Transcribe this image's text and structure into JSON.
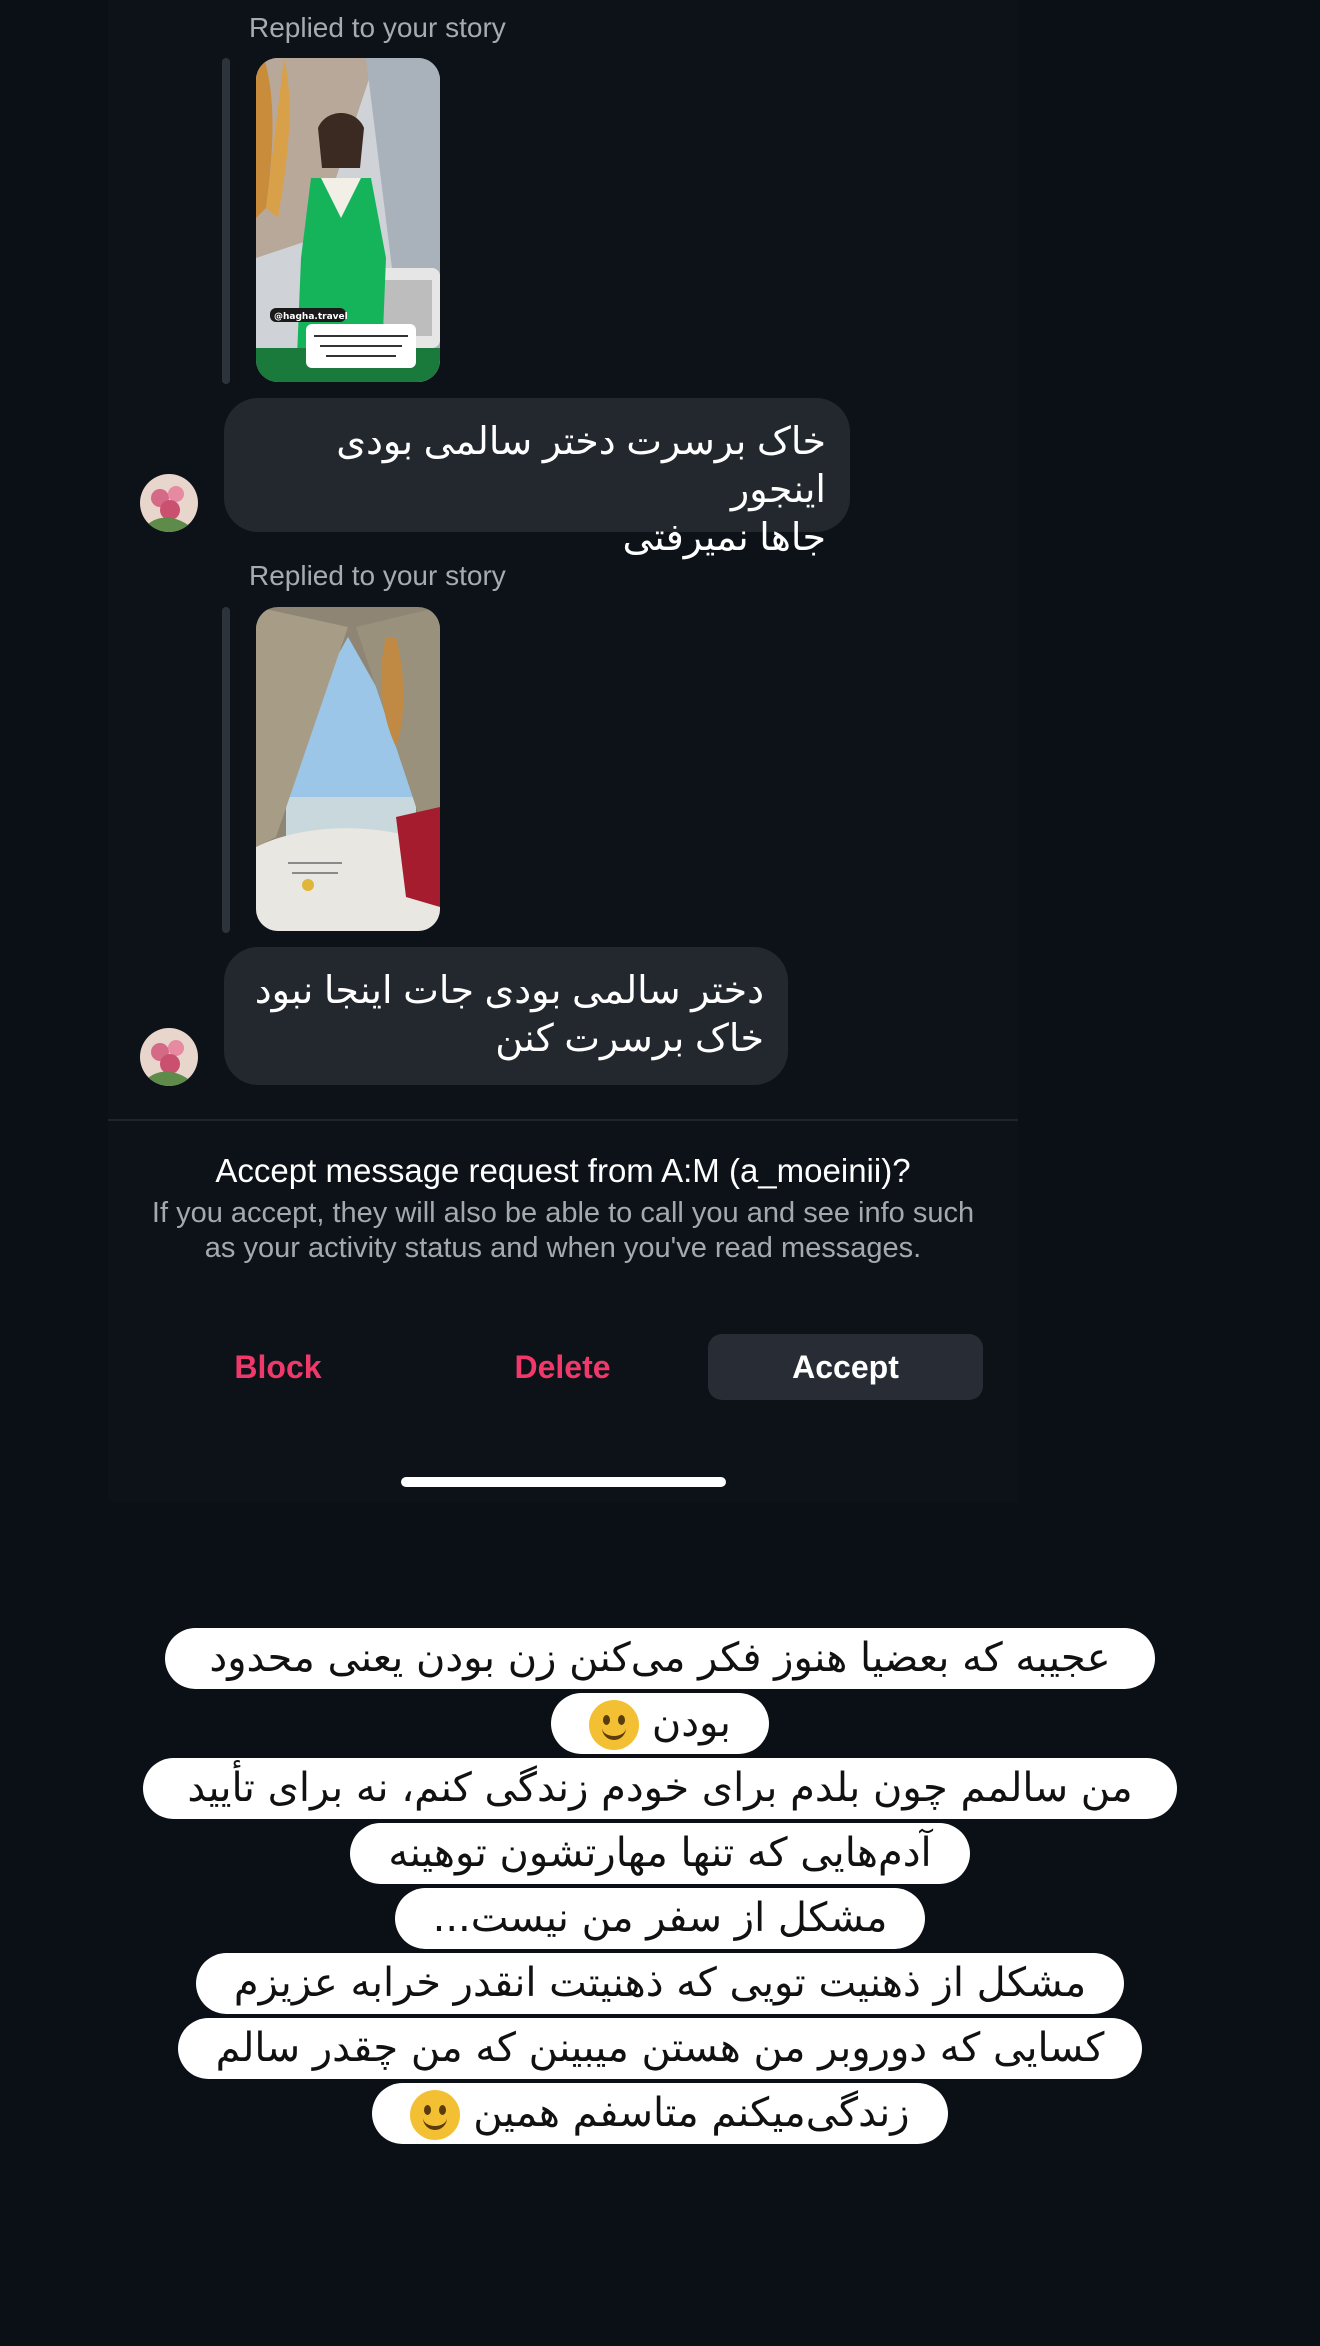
{
  "conversation": {
    "messages": [
      {
        "replied_label": "Replied to your story",
        "story_text": "@hagha.travel",
        "bubble_lines": [
          "خاک برسرت دختر سالمی بودی اینجور",
          "جاها نمیرفتی"
        ]
      },
      {
        "replied_label": "Replied to your story",
        "bubble_lines": [
          "دختر سالمی بودی جات اینجا نبود",
          "خاک برسرت کنن"
        ]
      }
    ]
  },
  "request": {
    "title": "Accept message request from A:M (a_moeinii)?",
    "body": "If you accept, they will also be able to call you and see info such as your activity status and when you've read messages.",
    "block_label": "Block",
    "delete_label": "Delete",
    "accept_label": "Accept"
  },
  "caption": {
    "lines": [
      "عجیبه که بعضیا هنوز فکر می‌کنن زن بودن یعنی محدود",
      "بودن",
      "من سالمم چون بلدم برای خودم زندگی کنم، نه برای تأیید",
      "آدم‌هایی که تنها مهارتشون توهینه",
      "مشکل از سفر من نیست...",
      "مشکل از ذهنیت تویی که ذهنیتت انقدر خرابه عزیزم",
      "کسایی که دوروبر من هستن میبینن که من چقدر سالم",
      "زندگی‌میکنم متاسفم همین"
    ],
    "emoji": "slightly-smiling-face"
  },
  "colors": {
    "background": "#0b1016",
    "bubble": "#23272e",
    "danger": "#f0386b",
    "accept_button": "#272c35"
  }
}
